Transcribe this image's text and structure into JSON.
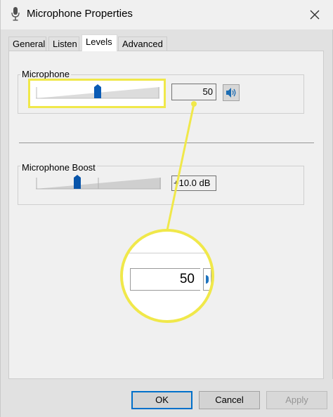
{
  "window": {
    "title": "Microphone Properties",
    "accent_color": "#0078d7",
    "highlight_color": "#f0e84a"
  },
  "tabs": [
    {
      "label": "General"
    },
    {
      "label": "Listen"
    },
    {
      "label": "Levels",
      "active": true
    },
    {
      "label": "Advanced"
    }
  ],
  "microphone": {
    "label": "Microphone",
    "value_text": "50",
    "level_fraction": 0.5,
    "zoom_value": "50"
  },
  "boost": {
    "label": "Microphone Boost",
    "value_text": "+10.0 dB",
    "level_fraction": 0.33
  },
  "buttons": {
    "ok": "OK",
    "cancel": "Cancel",
    "apply": "Apply"
  }
}
